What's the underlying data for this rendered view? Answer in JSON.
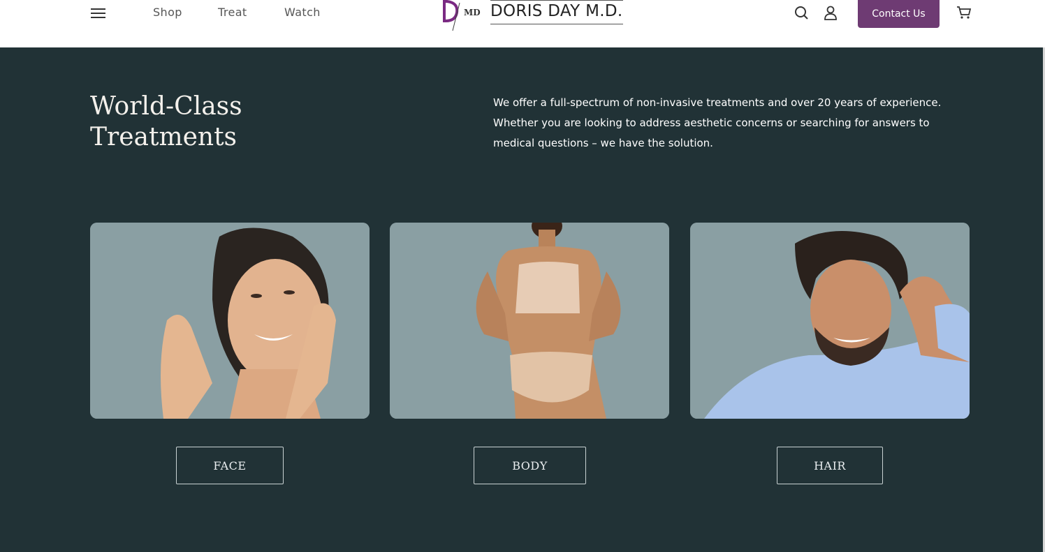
{
  "header": {
    "nav": [
      "Shop",
      "Treat",
      "Watch"
    ],
    "logo_text": "DORIS DAY M.D.",
    "logo_monogram": "DMD",
    "contact_label": "Contact Us",
    "icons": [
      "menu-icon",
      "search-icon",
      "user-icon",
      "cart-icon"
    ]
  },
  "section": {
    "title_line1": "World-Class",
    "title_line2": "Treatments",
    "description": "We offer a full-spectrum of non-invasive treatments and over 20 years of experience. Whether you are looking to address aesthetic concerns or searching for answers to medical questions – we have the solution."
  },
  "categories": [
    {
      "label": "FACE",
      "image": "woman-face-photo"
    },
    {
      "label": "BODY",
      "image": "woman-body-photo"
    },
    {
      "label": "HAIR",
      "image": "man-hair-photo"
    }
  ],
  "colors": {
    "background": "#213236",
    "accent": "#6e3b73",
    "card_bg": "#8a9fa3",
    "header_bg": "#ffffff"
  }
}
